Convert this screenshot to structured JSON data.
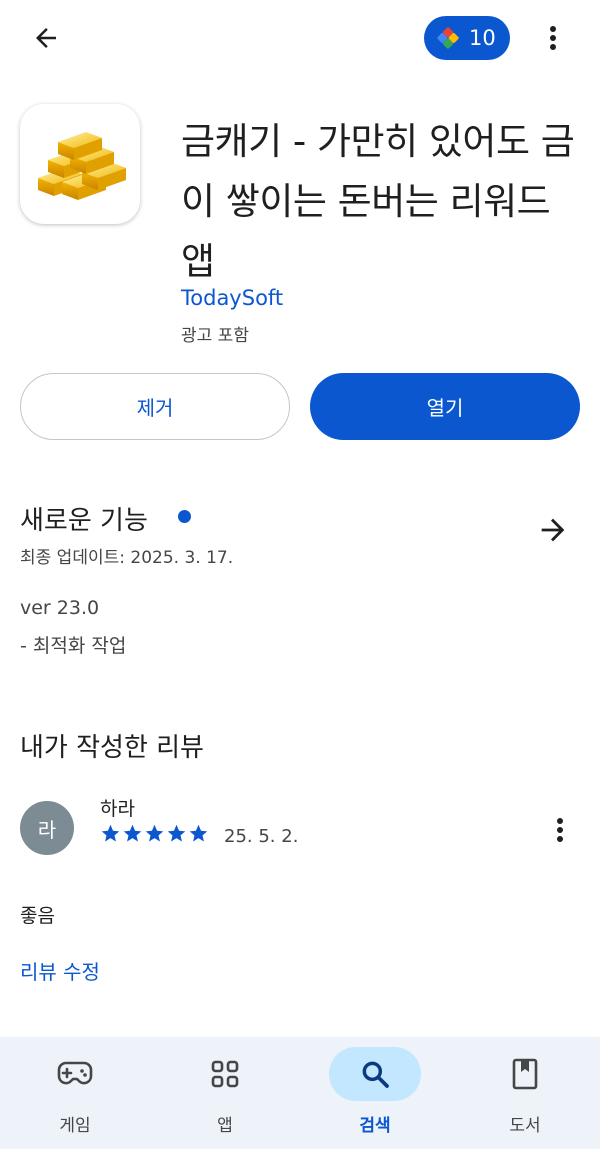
{
  "header": {
    "back_icon": "arrow-back-icon",
    "points_icon": "play-points-diamond-icon",
    "points_value": "10",
    "more_icon": "more-vert-icon"
  },
  "app": {
    "icon": "gold-bars-icon",
    "title": "금캐기 - 가만히 있어도 금이 쌓이는 돈버는 리워드 앱",
    "developer": "TodaySoft",
    "ads_note": "광고 포함"
  },
  "actions": {
    "uninstall_label": "제거",
    "open_label": "열기"
  },
  "whats_new": {
    "title": "새로운 기능",
    "updated_label": "최종 업데이트: 2025. 3. 17.",
    "version": "ver 23.0",
    "notes": "- 최적화 작업",
    "arrow_icon": "arrow-forward-icon"
  },
  "my_review": {
    "title": "내가 작성한 리뷰",
    "avatar_letter": "라",
    "reviewer": "하라",
    "rating": 5,
    "max_rating": 5,
    "date": "25. 5. 2.",
    "text": "좋음",
    "edit_label": "리뷰 수정"
  },
  "bottom_nav": {
    "items": [
      {
        "label": "게임",
        "icon": "gamepad-icon",
        "active": false
      },
      {
        "label": "앱",
        "icon": "apps-grid-icon",
        "active": false
      },
      {
        "label": "검색",
        "icon": "search-icon",
        "active": true
      },
      {
        "label": "도서",
        "icon": "book-icon",
        "active": false
      }
    ]
  },
  "colors": {
    "accent": "#0b57d0",
    "active_nav_bg": "#c2e7ff",
    "nav_bg": "#eef2f9",
    "avatar_bg": "#7d8c94"
  }
}
